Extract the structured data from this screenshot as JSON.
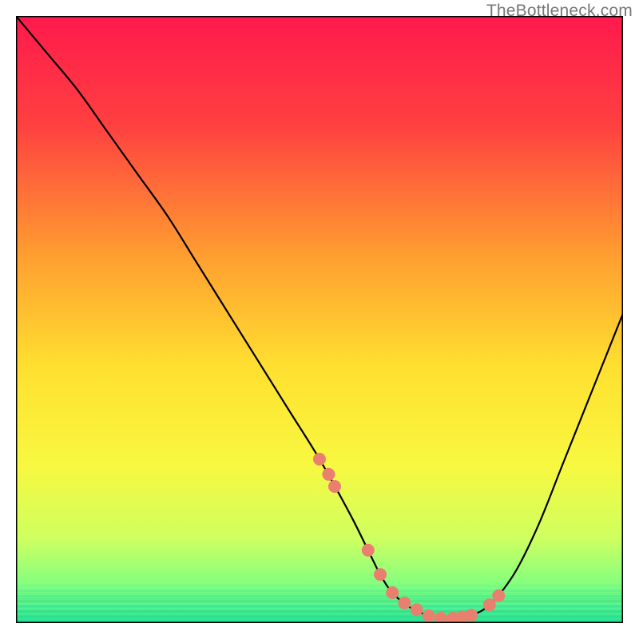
{
  "attribution": "TheBottleneck.com",
  "chart_data": {
    "type": "line",
    "title": "",
    "xlabel": "",
    "ylabel": "",
    "xlim": [
      0,
      100
    ],
    "ylim": [
      0,
      100
    ],
    "gradient_stops": [
      {
        "offset": 0,
        "color": "#ff1a4c"
      },
      {
        "offset": 0.18,
        "color": "#ff4040"
      },
      {
        "offset": 0.4,
        "color": "#ffa030"
      },
      {
        "offset": 0.58,
        "color": "#ffe030"
      },
      {
        "offset": 0.74,
        "color": "#f8f840"
      },
      {
        "offset": 0.86,
        "color": "#cfff60"
      },
      {
        "offset": 0.94,
        "color": "#80ff80"
      },
      {
        "offset": 1.0,
        "color": "#20e090"
      }
    ],
    "series": [
      {
        "name": "curve",
        "type": "line",
        "color": "#000000",
        "x": [
          0,
          5,
          10,
          15,
          20,
          25,
          30,
          35,
          40,
          45,
          50,
          55,
          58,
          60,
          62,
          65,
          68,
          70,
          72,
          75,
          78,
          82,
          86,
          90,
          94,
          98,
          100
        ],
        "y": [
          100,
          94,
          88,
          81,
          74,
          67,
          59,
          51,
          43,
          35,
          27,
          18,
          12,
          8,
          5,
          2.5,
          1.2,
          0.8,
          0.8,
          1.3,
          3,
          8,
          16,
          26,
          36,
          46,
          51
        ]
      },
      {
        "name": "markers",
        "type": "scatter",
        "color": "#e9806f",
        "x": [
          50,
          51.5,
          52.5,
          58,
          60,
          62,
          64,
          66,
          68,
          70,
          72,
          73.5,
          75,
          78,
          79.5
        ],
        "y": [
          27,
          24.5,
          22.5,
          12,
          8,
          5,
          3.3,
          2.2,
          1.2,
          0.8,
          0.8,
          1.0,
          1.3,
          3,
          4.5
        ]
      }
    ]
  }
}
